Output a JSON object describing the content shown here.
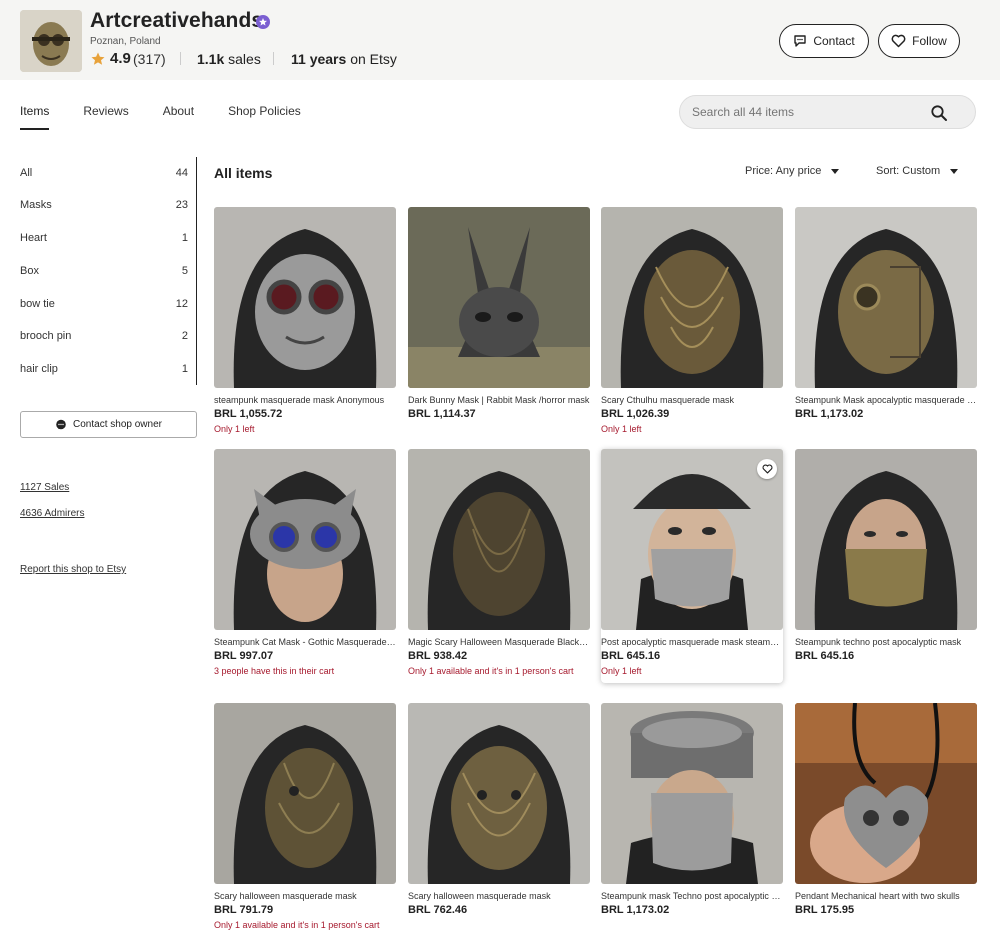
{
  "shop": {
    "name": "Artcreativehands",
    "location": "Poznan, Poland",
    "rating": "4.9",
    "rating_count": "(317)",
    "sales_count": "1.1k",
    "sales_label": "sales",
    "years_count": "11 years",
    "years_label": "on Etsy",
    "contact_label": "Contact",
    "follow_label": "Follow"
  },
  "tabs": [
    "Items",
    "Reviews",
    "About",
    "Shop Policies"
  ],
  "search": {
    "placeholder": "Search all 44 items"
  },
  "sidebar": {
    "categories": [
      {
        "label": "All",
        "count": "44"
      },
      {
        "label": "Masks",
        "count": "23"
      },
      {
        "label": "Heart",
        "count": "1"
      },
      {
        "label": "Box",
        "count": "5"
      },
      {
        "label": "bow tie",
        "count": "12"
      },
      {
        "label": "brooch pin",
        "count": "2"
      },
      {
        "label": "hair clip",
        "count": "1"
      }
    ],
    "contact_owner": "Contact shop owner",
    "sales_link": "1127 Sales",
    "admirers_link": "4636 Admirers",
    "report_link": "Report this shop to Etsy"
  },
  "main": {
    "heading": "All items",
    "price_filter": "Price: Any price",
    "sort": "Sort: Custom"
  },
  "products": [
    {
      "title": "steampunk masquerade mask Anonymous",
      "price": "BRL 1,055.72",
      "note": "Only 1 left"
    },
    {
      "title": "Dark Bunny Mask | Rabbit Mask /horror mask",
      "price": "BRL 1,114.37",
      "note": ""
    },
    {
      "title": "Scary Cthulhu masquerade mask",
      "price": "BRL 1,026.39",
      "note": "Only 1 left"
    },
    {
      "title": "Steampunk Mask apocalyptic masquerade mask",
      "price": "BRL 1,173.02",
      "note": ""
    },
    {
      "title": "Steampunk Cat Mask - Gothic Masquerade Mask",
      "price": "BRL 997.07",
      "note": "3 people have this in their cart"
    },
    {
      "title": "Magic Scary Halloween Masquerade Black Mask",
      "price": "BRL 938.42",
      "note": "Only 1 available and it's in 1 person's cart"
    },
    {
      "title": "Post apocalyptic masquerade mask steampunk",
      "price": "BRL 645.16",
      "note": "Only 1 left"
    },
    {
      "title": "Steampunk techno post apocalyptic mask",
      "price": "BRL 645.16",
      "note": ""
    },
    {
      "title": "Scary halloween masquerade mask",
      "price": "BRL 791.79",
      "note": "Only 1 available and it's in 1 person's cart"
    },
    {
      "title": "Scary halloween masquerade mask",
      "price": "BRL 762.46",
      "note": ""
    },
    {
      "title": "Steampunk mask Techno post apocalyptic mask",
      "price": "BRL 1,173.02",
      "note": ""
    },
    {
      "title": "Pendant Mechanical heart with two skulls",
      "price": "BRL 175.95",
      "note": ""
    }
  ],
  "colors": {
    "accent_purple": "#7b5fd1",
    "note_red": "#a61a2e",
    "star": "#e8a23a"
  }
}
